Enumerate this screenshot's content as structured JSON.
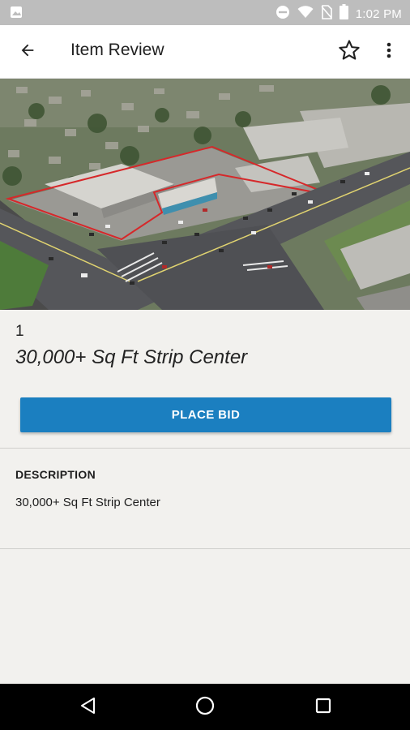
{
  "status_bar": {
    "time": "1:02 PM",
    "icons": [
      "notification-image-icon",
      "do-not-disturb-icon",
      "wifi-icon",
      "no-sim-icon",
      "battery-icon"
    ]
  },
  "app_bar": {
    "title": "Item Review",
    "back_icon": "arrow-back-icon",
    "favorite_icon": "star-outline-icon",
    "overflow_icon": "more-vert-icon"
  },
  "item": {
    "lot_number": "1",
    "title": "30,000+ Sq Ft Strip Center",
    "photo_alt": "Aerial view of strip center property"
  },
  "actions": {
    "place_bid_label": "PLACE BID"
  },
  "description": {
    "heading": "DESCRIPTION",
    "text": "30,000+ Sq Ft Strip Center"
  },
  "nav_bar": {
    "icons": [
      "back-triangle-icon",
      "home-circle-icon",
      "recents-square-icon"
    ]
  },
  "colors": {
    "accent": "#1b7fc0",
    "background": "#f2f1ee",
    "status_bar": "#bdbdbd"
  }
}
